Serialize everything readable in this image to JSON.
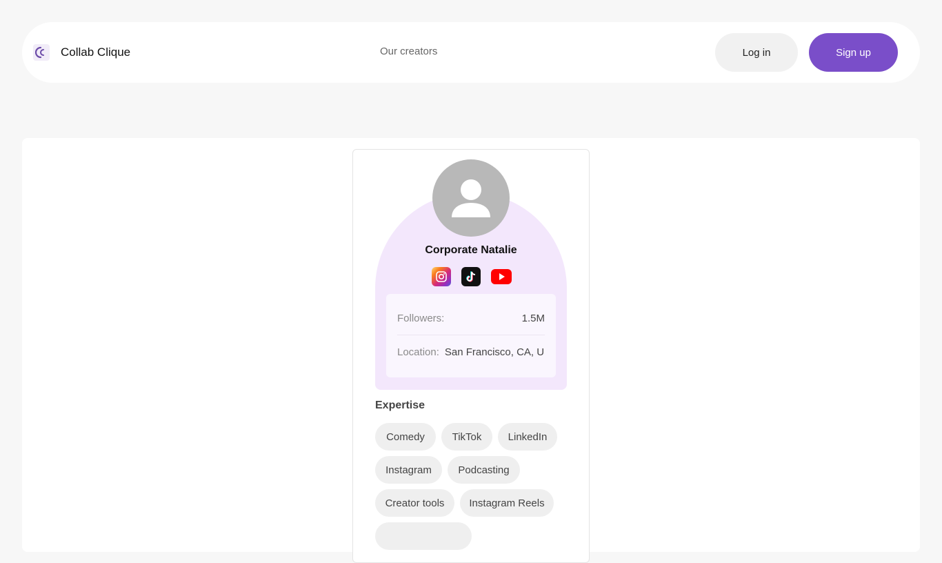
{
  "brand": {
    "name": "Collab Clique",
    "logo_icon": "collab-clique-logo-icon"
  },
  "nav": {
    "link_creators": "Our creators"
  },
  "auth": {
    "login_label": "Log in",
    "signup_label": "Sign up"
  },
  "profile": {
    "name": "Corporate Natalie",
    "avatar_icon": "person-placeholder-icon",
    "socials": [
      {
        "platform": "instagram",
        "icon": "instagram-icon"
      },
      {
        "platform": "tiktok",
        "icon": "tiktok-icon"
      },
      {
        "platform": "youtube",
        "icon": "youtube-icon"
      }
    ],
    "stats": {
      "followers_label": "Followers:",
      "followers_value": "1.5M",
      "location_label": "Location:",
      "location_value": "San Francisco, CA, USA"
    }
  },
  "expertise": {
    "title": "Expertise",
    "tags": [
      "Comedy",
      "TikTok",
      "LinkedIn",
      "Instagram",
      "Podcasting",
      "Creator tools",
      "Instagram Reels"
    ]
  },
  "colors": {
    "accent": "#7a4ec9",
    "arch_bg": "#f3e7fc",
    "page_bg": "#f7f7f7"
  }
}
